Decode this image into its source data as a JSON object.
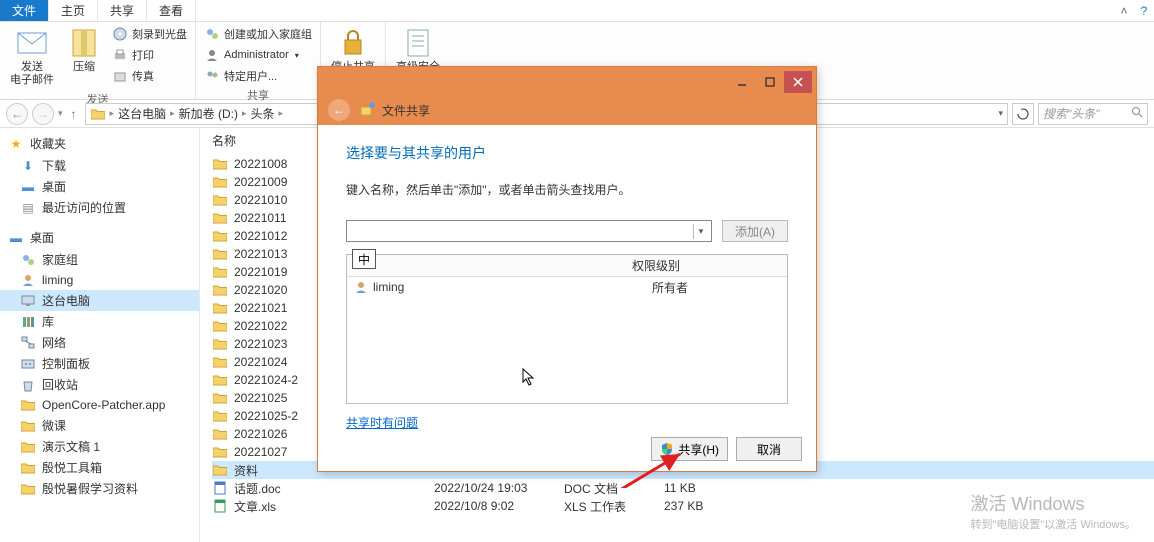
{
  "tabs": {
    "file": "文件",
    "home": "主页",
    "share": "共享",
    "view": "查看"
  },
  "ribbon": {
    "send": {
      "label1": "发送",
      "label2": "电子邮件"
    },
    "compress": "压缩",
    "burn": "刻录到光盘",
    "print": "打印",
    "fax": "传真",
    "group_send": "发送",
    "homegroup": "创建或加入家庭组",
    "admin": "Administrator",
    "specific": "特定用户...",
    "group_share": "共享",
    "stop_share": "停止共享",
    "adv_sec": "高级安全"
  },
  "nav": {
    "back": "←",
    "fwd": "→",
    "up": "↑",
    "pc": "这台电脑",
    "vol": "新加卷 (D:)",
    "folder": "头条",
    "search_ph": "搜索\"头条\""
  },
  "sidebar": {
    "fav": "收藏夹",
    "downloads": "下载",
    "desktop": "桌面",
    "recent": "最近访问的位置",
    "desk_cat": "桌面",
    "homegroup": "家庭组",
    "liming": "liming",
    "thispc": "这台电脑",
    "libraries": "库",
    "network": "网络",
    "control": "控制面板",
    "recycle": "回收站",
    "opencore": "OpenCore-Patcher.app",
    "weike": "微课",
    "demo": "演示文稿 1",
    "tools": "殷悦工具箱",
    "summer": "殷悦暑假学习资料"
  },
  "list": {
    "hdr_name": "名称",
    "items": [
      "20221008",
      "20221009",
      "20221010",
      "20221011",
      "20221012",
      "20221013",
      "20221019",
      "20221020",
      "20221021",
      "20221022",
      "20221023",
      "20221024",
      "20221024-2",
      "20221025",
      "20221025-2",
      "20221026",
      "20221027",
      "资料"
    ],
    "doc": "话题.doc",
    "xls": "文章.xls",
    "doc_date": "2022/10/24 19:03",
    "doc_type": "DOC 文档",
    "doc_size": "11 KB",
    "xls_date": "2022/10/8 9:02",
    "xls_type": "XLS 工作表",
    "xls_size": "237 KB"
  },
  "dialog": {
    "title": "文件共享",
    "heading": "选择要与其共享的用户",
    "instruction": "键入名称，然后单击\"添加\"，或者单击箭头查找用户。",
    "add": "添加(A)",
    "ime": "中",
    "col_perm": "权限级别",
    "user": "liming",
    "perm": "所有者",
    "trouble": "共享时有问题",
    "share_btn": "共享(H)",
    "cancel": "取消"
  },
  "watermark": {
    "l1": "激活 Windows",
    "l2": "转到\"电脑设置\"以激活 Windows。"
  }
}
